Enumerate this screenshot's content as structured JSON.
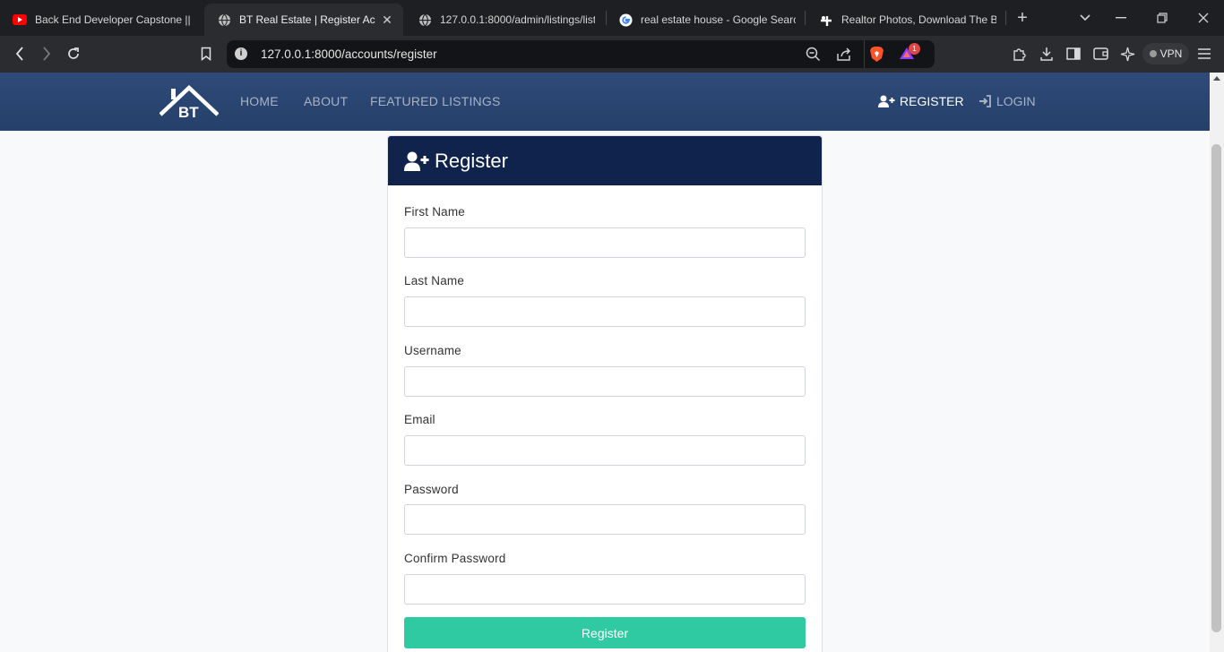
{
  "browser": {
    "tabs": [
      {
        "title": "Back End Developer Capstone || B",
        "icon": "youtube-icon",
        "active": false
      },
      {
        "title": "BT Real Estate | Register Acco",
        "icon": "globe-icon",
        "active": true
      },
      {
        "title": "127.0.0.1:8000/admin/listings/list",
        "icon": "globe-icon",
        "active": false
      },
      {
        "title": "real estate house - Google Search",
        "icon": "google-icon",
        "active": false
      },
      {
        "title": "Realtor Photos, Download The BE",
        "icon": "realtor-icon",
        "active": false
      }
    ],
    "url": "127.0.0.1:8000/accounts/register",
    "brave_badge_count": "1",
    "vpn_label": "VPN"
  },
  "site": {
    "logo_text": "BT",
    "nav": {
      "home": "HOME",
      "about": "ABOUT",
      "featured": "FEATURED LISTINGS",
      "register": "REGISTER",
      "login": "LOGIN"
    }
  },
  "form": {
    "title": "Register",
    "fields": [
      {
        "label": "First Name",
        "value": ""
      },
      {
        "label": "Last Name",
        "value": ""
      },
      {
        "label": "Username",
        "value": ""
      },
      {
        "label": "Email",
        "value": ""
      },
      {
        "label": "Password",
        "value": ""
      },
      {
        "label": "Confirm Password",
        "value": ""
      }
    ],
    "submit_label": "Register"
  },
  "colors": {
    "navbar": "#2f4a78",
    "card_header": "#0f234d",
    "submit": "#2fcaa2",
    "page_bg": "#f8f9fa"
  }
}
